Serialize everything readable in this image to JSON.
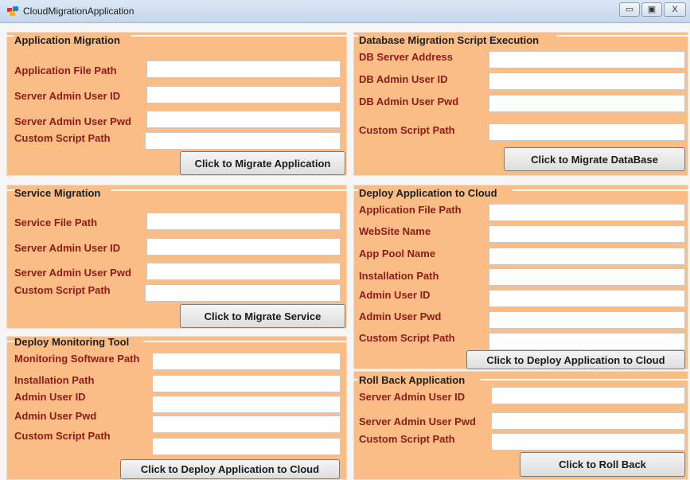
{
  "window": {
    "title": "CloudMigrationApplication",
    "minimize_glyph": "▭",
    "maximize_glyph": "▣",
    "close_glyph": "X"
  },
  "app_migration": {
    "title": "Application Migration",
    "fields": [
      {
        "label": "Application File Path",
        "value": ""
      },
      {
        "label": "Server Admin User ID",
        "value": ""
      },
      {
        "label": "Server Admin User Pwd",
        "value": ""
      },
      {
        "label": "Custom Script Path",
        "value": ""
      }
    ],
    "button": "Click to Migrate Application"
  },
  "db_migration": {
    "title": "Database Migration Script Execution",
    "fields": [
      {
        "label": "DB Server Address",
        "value": ""
      },
      {
        "label": "DB Admin User ID",
        "value": ""
      },
      {
        "label": "DB Admin User Pwd",
        "value": ""
      },
      {
        "label": "Custom Script Path",
        "value": ""
      }
    ],
    "button": "Click to Migrate DataBase"
  },
  "service_migration": {
    "title": "Service Migration",
    "fields": [
      {
        "label": "Service File Path",
        "value": ""
      },
      {
        "label": "Server Admin User ID",
        "value": ""
      },
      {
        "label": "Server Admin User Pwd",
        "value": ""
      },
      {
        "label": "Custom Script Path",
        "value": ""
      }
    ],
    "button": "Click to Migrate Service"
  },
  "deploy_cloud": {
    "title": "Deploy Application to Cloud",
    "fields": [
      {
        "label": "Application File Path",
        "value": ""
      },
      {
        "label": "WebSite Name",
        "value": ""
      },
      {
        "label": "App Pool Name",
        "value": ""
      },
      {
        "label": "Installation Path",
        "value": ""
      },
      {
        "label": "Admin User ID",
        "value": ""
      },
      {
        "label": "Admin User Pwd",
        "value": ""
      },
      {
        "label": "Custom Script Path",
        "value": ""
      }
    ],
    "button": "Click to Deploy Application to Cloud"
  },
  "monitoring": {
    "title": "Deploy Monitoring Tool",
    "fields": [
      {
        "label": "Monitoring Software Path",
        "value": ""
      },
      {
        "label": "Installation Path",
        "value": ""
      },
      {
        "label": "Admin User ID",
        "value": ""
      },
      {
        "label": "Admin User Pwd",
        "value": ""
      },
      {
        "label": "Custom Script Path",
        "value": ""
      }
    ],
    "button": "Click to Deploy Application to Cloud"
  },
  "rollback": {
    "title": "Roll Back Application",
    "fields": [
      {
        "label": "Server Admin User ID",
        "value": ""
      },
      {
        "label": "Server Admin User Pwd",
        "value": ""
      },
      {
        "label": "Custom Script Path",
        "value": ""
      }
    ],
    "button": "Click to Roll Back"
  },
  "colors": {
    "panel_background": "#fbbd86",
    "label_text": "#8e1b18",
    "title_text": "#1e1e1e"
  }
}
